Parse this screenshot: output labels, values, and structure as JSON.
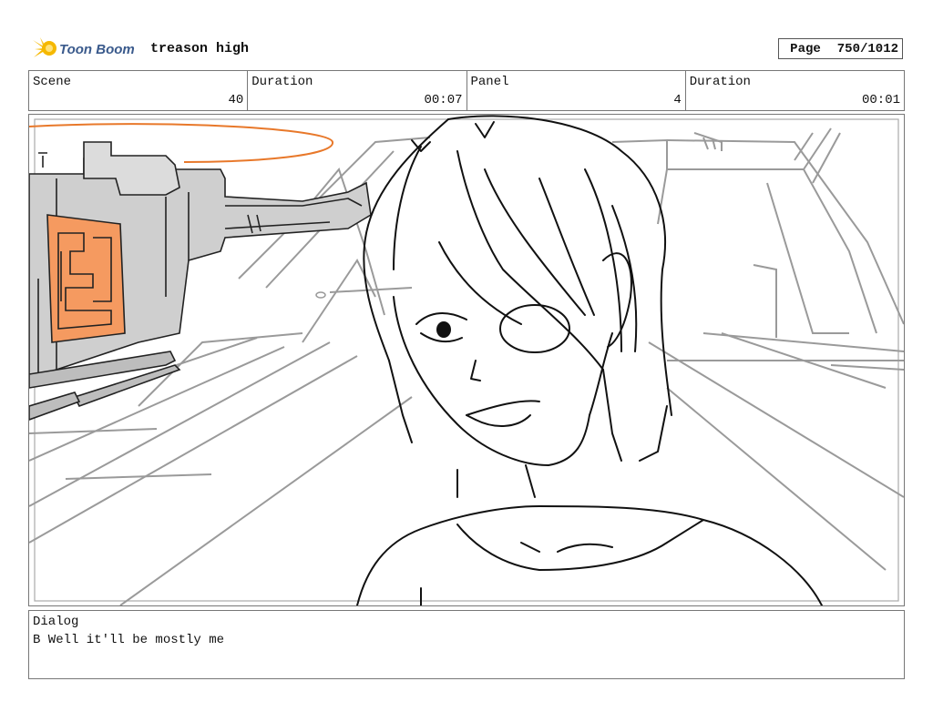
{
  "header": {
    "logo_text": "Toon Boom",
    "project_title": "treason high",
    "page_label": "Page",
    "page_number": "750/1012"
  },
  "info": {
    "scene_label": "Scene",
    "scene_value": "40",
    "duration1_label": "Duration",
    "duration1_value": "00:07",
    "panel_label": "Panel",
    "panel_value": "4",
    "duration2_label": "Duration",
    "duration2_value": "00:01"
  },
  "dialog": {
    "label": "Dialog",
    "text": "B Well it'll be mostly me"
  },
  "colors": {
    "logo_yellow": "#f5b800",
    "logo_text": "#3a5a8c",
    "accent_orange": "#f59a60",
    "orange_line": "#e8782a",
    "machine_gray": "#cfcfcf"
  }
}
